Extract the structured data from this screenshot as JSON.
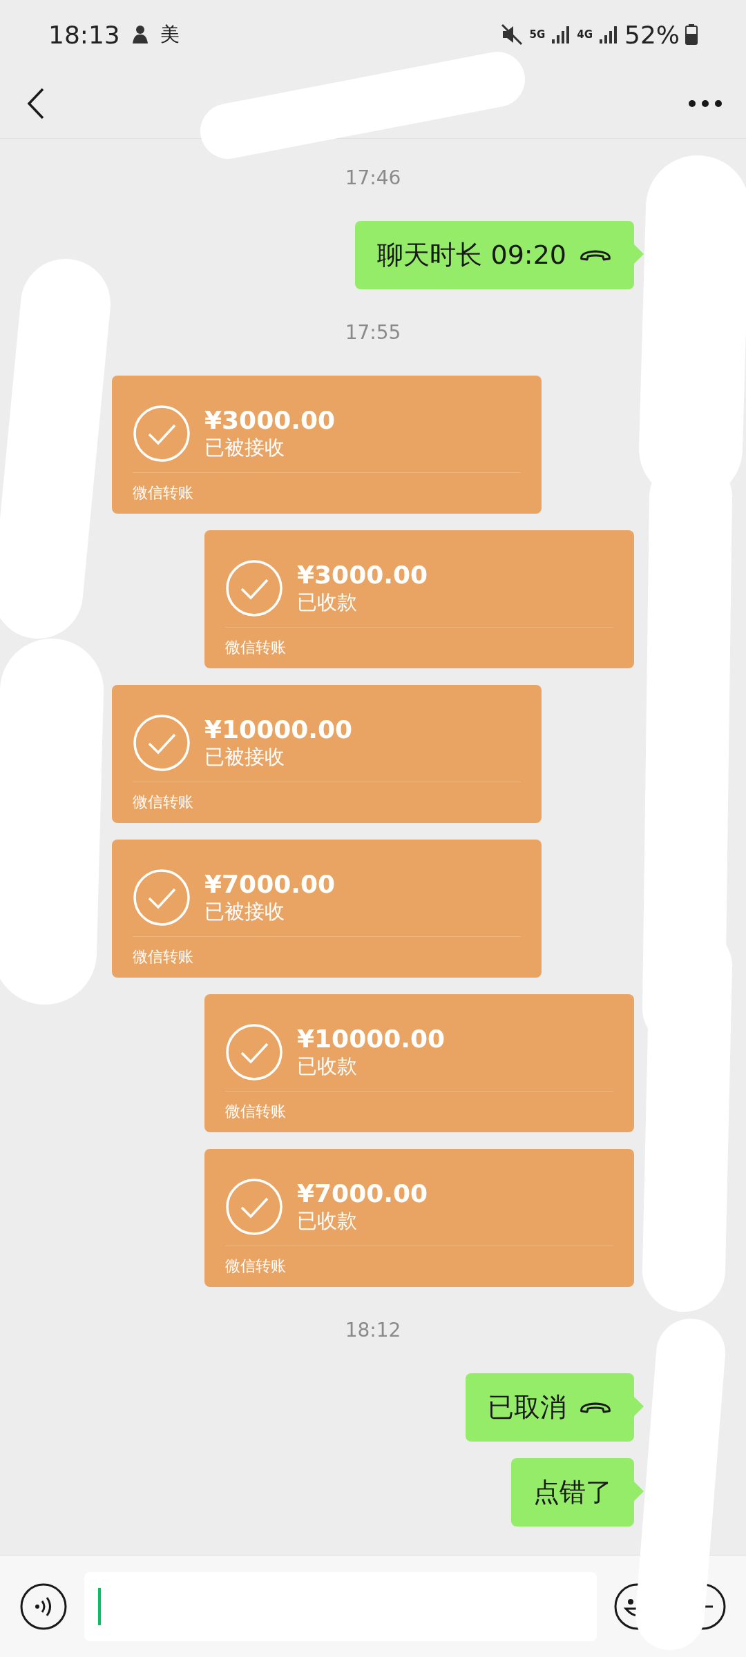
{
  "status_bar": {
    "time": "18:13",
    "carrier_label": "美",
    "net_5g": "5G",
    "net_4g": "4G",
    "battery": "52%"
  },
  "messages": [
    {
      "kind": "time",
      "text": "17:46"
    },
    {
      "kind": "call",
      "outgoing": true,
      "text": "聊天时长 09:20"
    },
    {
      "kind": "time",
      "text": "17:55"
    },
    {
      "kind": "transfer",
      "outgoing": false,
      "amount": "¥3000.00",
      "status": "已被接收",
      "footer": "微信转账"
    },
    {
      "kind": "transfer",
      "outgoing": true,
      "amount": "¥3000.00",
      "status": "已收款",
      "footer": "微信转账"
    },
    {
      "kind": "transfer",
      "outgoing": false,
      "amount": "¥10000.00",
      "status": "已被接收",
      "footer": "微信转账"
    },
    {
      "kind": "transfer",
      "outgoing": false,
      "amount": "¥7000.00",
      "status": "已被接收",
      "footer": "微信转账"
    },
    {
      "kind": "transfer",
      "outgoing": true,
      "amount": "¥10000.00",
      "status": "已收款",
      "footer": "微信转账"
    },
    {
      "kind": "transfer",
      "outgoing": true,
      "amount": "¥7000.00",
      "status": "已收款",
      "footer": "微信转账"
    },
    {
      "kind": "time",
      "text": "18:12"
    },
    {
      "kind": "call",
      "outgoing": true,
      "text": "已取消"
    },
    {
      "kind": "text",
      "outgoing": true,
      "text": "点错了"
    }
  ]
}
